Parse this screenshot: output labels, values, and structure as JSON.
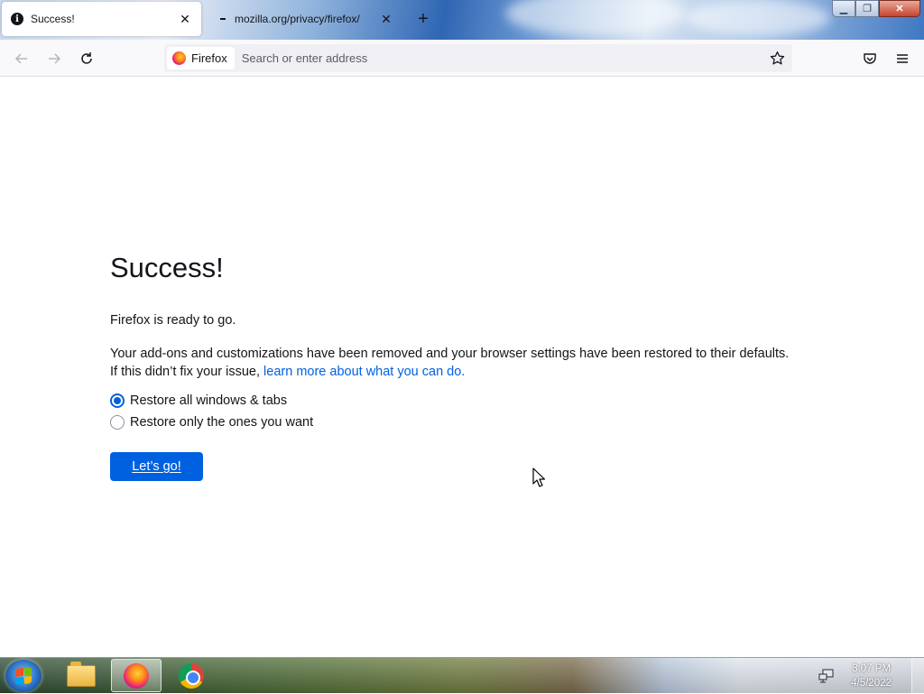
{
  "tabs": [
    {
      "title": "Success!",
      "icon": "info-icon",
      "icon_glyph": "i",
      "active": true
    },
    {
      "title": "mozilla.org/privacy/firefox/",
      "icon": "loading-dash-icon",
      "active": false
    }
  ],
  "tab_close_glyph": "✕",
  "new_tab_glyph": "+",
  "window_controls": {
    "minimize": "▁",
    "restore": "❐",
    "close": "✕"
  },
  "urlbar": {
    "identity_label": "Firefox",
    "placeholder": "Search or enter address"
  },
  "content": {
    "title": "Success!",
    "ready_text": "Firefox is ready to go.",
    "body_line1": "Your add-ons and customizations have been removed and your browser settings have been restored to their defaults.",
    "body_line2_prefix": "If this didn’t fix your issue, ",
    "learn_more_link": "learn more about what you can do.",
    "options": [
      {
        "label": "Restore all windows & tabs",
        "selected": true
      },
      {
        "label": "Restore only the ones you want",
        "selected": false
      }
    ],
    "button_label": "Let’s go!"
  },
  "taskbar": {
    "items": [
      "windows-explorer",
      "firefox",
      "chrome"
    ],
    "active_item": "firefox",
    "time": "3:07 PM",
    "date": "4/5/2022"
  },
  "colors": {
    "accent": "#0061e0",
    "text": "#15141a",
    "muted": "#5b5b66"
  }
}
